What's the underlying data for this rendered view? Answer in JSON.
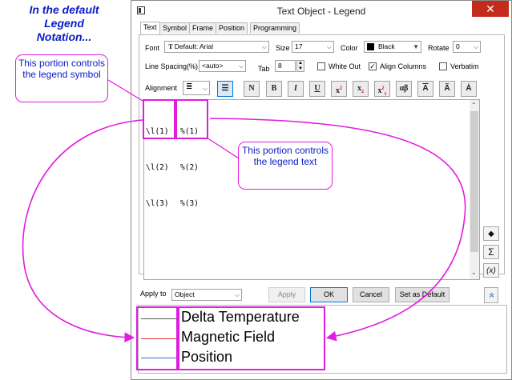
{
  "heading": {
    "lines": [
      "In the default",
      "Legend",
      "Notation..."
    ]
  },
  "window": {
    "title": "Text Object - Legend",
    "close_glyph": "✕"
  },
  "tabs": [
    "Text",
    "Symbol",
    "Frame",
    "Position",
    "Programming"
  ],
  "font_row": {
    "font_label": "Font",
    "font_value": "Default: Arial",
    "size_label": "Size",
    "size_value": "17",
    "color_label": "Color",
    "color_value": "Black",
    "color_swatch": "#000000",
    "rotate_label": "Rotate",
    "rotate_value": "0"
  },
  "spacing_row": {
    "line_spacing_label": "Line Spacing(%)",
    "line_spacing_value": "<auto>",
    "tab_label": "Tab",
    "tab_value": "8",
    "white_out_label": "White Out",
    "white_out_checked": false,
    "align_columns_label": "Align Columns",
    "align_columns_checked": true,
    "verbatim_label": "Verbatim",
    "verbatim_checked": false
  },
  "format_row": {
    "alignment_label": "Alignment",
    "buttons": [
      "N",
      "B",
      "I",
      "U",
      "x2",
      "x2",
      "x21",
      "αβ",
      "A",
      "Ã",
      "Ȧ"
    ]
  },
  "editor": {
    "symbol_lines": [
      "\\l(1)",
      "\\l(2)",
      "\\l(3)"
    ],
    "text_lines": [
      "%(1)",
      "%(2)",
      "%(3)"
    ]
  },
  "side_buttons": [
    "◆",
    "Σ",
    "(x)",
    "»"
  ],
  "apply_to": {
    "label": "Apply to",
    "value": "Object"
  },
  "buttons": {
    "apply": "Apply",
    "ok": "OK",
    "cancel": "Cancel",
    "set_default": "Set as Default"
  },
  "preview": {
    "entries": [
      {
        "text": "Delta Temperature",
        "color": "#555555"
      },
      {
        "text": "Magnetic Field",
        "color": "#e03030"
      },
      {
        "text": "Position",
        "color": "#3a6ad8"
      }
    ]
  },
  "annotations": {
    "symbol_callout": "This portion controls the legend symbol",
    "text_callout": "This portion controls the legend text",
    "accent_color": "#e01ce0",
    "callout_text_color": "#0a1cc8"
  }
}
